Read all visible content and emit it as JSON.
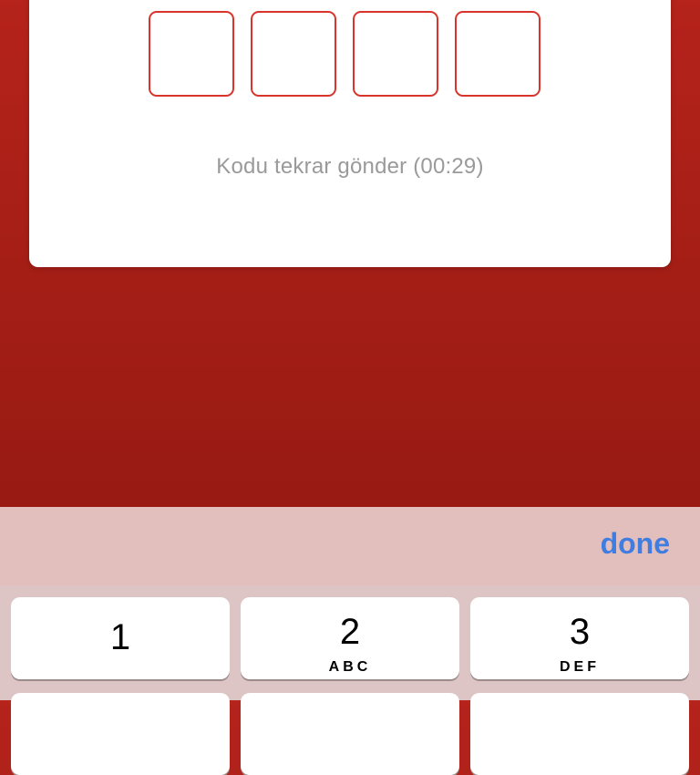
{
  "verification": {
    "otp_boxes": [
      "",
      "",
      "",
      ""
    ],
    "resend_label": "Kodu tekrar gönder (00:29)"
  },
  "keyboard": {
    "done_label": "done",
    "keys": [
      {
        "number": "1",
        "letters": ""
      },
      {
        "number": "2",
        "letters": "ABC"
      },
      {
        "number": "3",
        "letters": "DEF"
      }
    ]
  }
}
